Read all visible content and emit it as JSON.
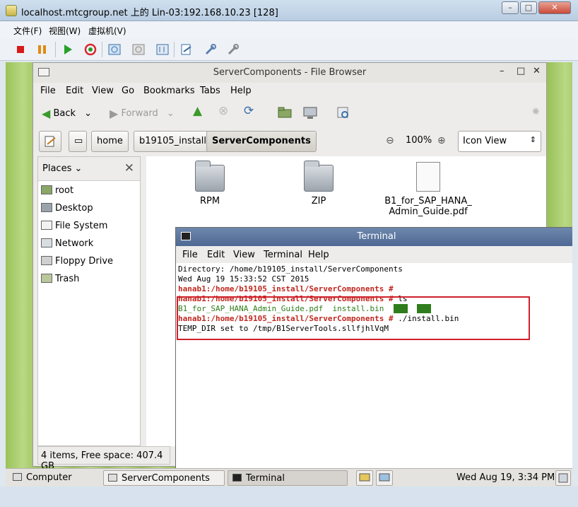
{
  "outer_window": {
    "title": "localhost.mtcgroup.net 上的 Lin-03:192.168.10.23 [128]",
    "menu": [
      "文件(F)",
      "视图(W)",
      "虚拟机(V)"
    ]
  },
  "toolbar_icons": [
    "stop-icon",
    "pause-icon",
    "play-icon",
    "reset-icon",
    "snapshot-icon",
    "revert-icon",
    "manage-snapshots-icon",
    "preferences-icon",
    "tools-icon",
    "settings-icon"
  ],
  "file_browser": {
    "title": "ServerComponents - File Browser",
    "menu": [
      "File",
      "Edit",
      "View",
      "Go",
      "Bookmarks",
      "Tabs",
      "Help"
    ],
    "back_label": "Back",
    "forward_label": "Forward",
    "path": [
      "home",
      "b19105_install",
      "ServerComponents"
    ],
    "zoom": "100%",
    "view_mode": "Icon View",
    "places_label": "Places",
    "places": [
      "root",
      "Desktop",
      "File System",
      "Network",
      "Floppy Drive",
      "Trash"
    ],
    "files": [
      {
        "name": "RPM",
        "type": "folder"
      },
      {
        "name": "ZIP",
        "type": "folder"
      },
      {
        "name_line1": "B1_for_SAP_HANA_",
        "name_line2": "Admin_Guide.pdf",
        "type": "document"
      }
    ],
    "status": "4 items, Free space: 407.4 GB"
  },
  "terminal": {
    "title": "Terminal",
    "menu": [
      "File",
      "Edit",
      "View",
      "Terminal",
      "Help"
    ],
    "lines": {
      "dir": "Directory: /home/b19105_install/ServerComponents",
      "date": "Wed Aug 19 15:33:52 CST 2015",
      "prompt": "hanab1:/home/b19105_install/ServerComponents #",
      "cmd_ls": " ls",
      "ls_out1": "B1_for_SAP_HANA_Admin_Guide.pdf",
      "ls_out2": "  install.bin  ",
      "ls_rpm": "RPM",
      "ls_zip": "ZIP",
      "cmd_install": " ./install.bin",
      "temp": "TEMP_DIR set to /tmp/B1ServerTools.sllfjhlVqM"
    }
  },
  "taskbar": {
    "computer": "Computer",
    "task1": "ServerComponents -...",
    "task2": "Terminal",
    "clock": "Wed Aug 19,  3:34 PM"
  }
}
